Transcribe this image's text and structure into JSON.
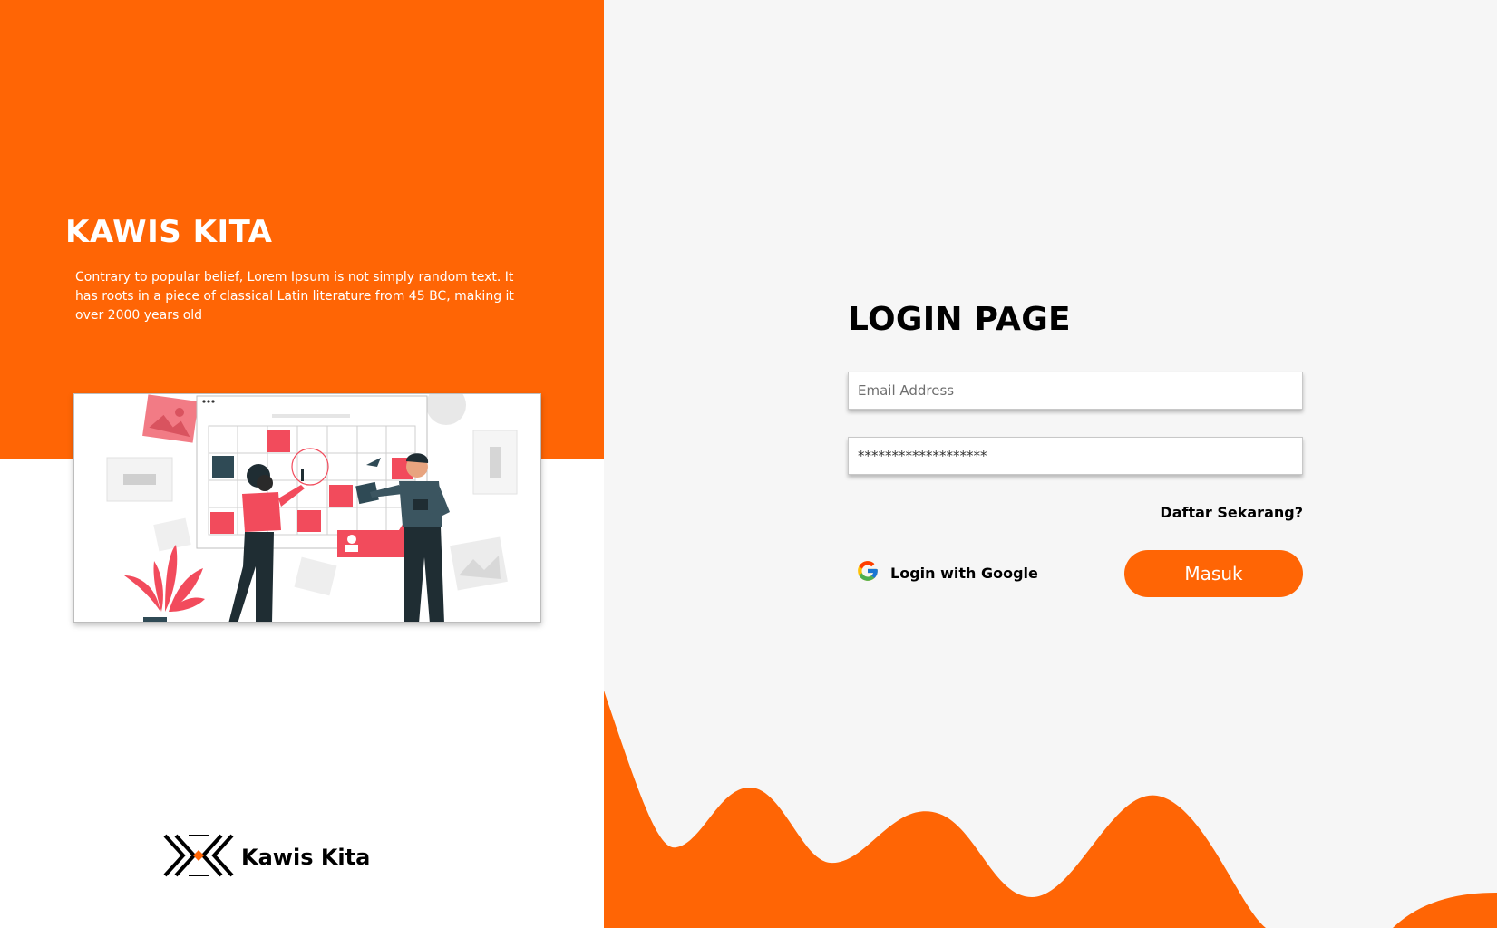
{
  "brand": {
    "title": "KAWIS KITA",
    "description": "Contrary to popular belief, Lorem Ipsum is not simply random text. It has roots in a piece of classical Latin literature from 45 BC, making it over 2000 years old",
    "logo_name": "Kawis Kita"
  },
  "login": {
    "title": "LOGIN PAGE",
    "email_placeholder": "Email Address",
    "password_value": "*******************",
    "register_label": "Daftar Sekarang?",
    "google_label": "Login with Google",
    "submit_label": "Masuk"
  },
  "icons": {
    "google": "google-g-icon",
    "logo": "kawis-kita-logo-icon",
    "illustration": "calendar-planning-illustration"
  },
  "colors": {
    "accent": "#ff6505",
    "panel_bg": "#f6f6f6"
  }
}
